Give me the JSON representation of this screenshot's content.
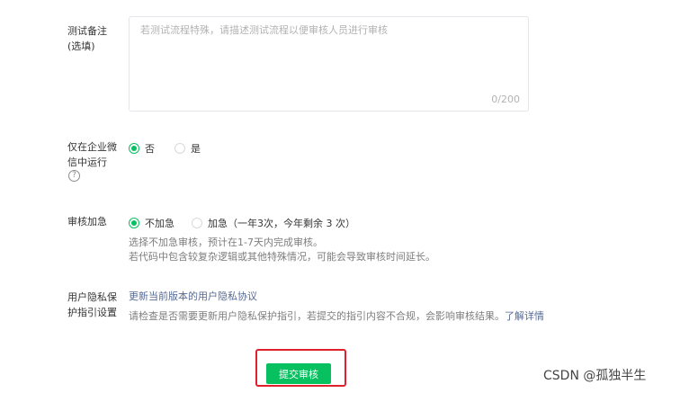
{
  "remark": {
    "label_line1": "测试备注",
    "label_line2": "(选填)",
    "placeholder": "若测试流程特殊，请描述测试流程以便审核人员进行审核",
    "counter": "0/200"
  },
  "wecom_only": {
    "label_line1": "仅在企业微",
    "label_line2": "信中运行",
    "help_icon": "?",
    "options": [
      {
        "label": "否",
        "checked": true
      },
      {
        "label": "是",
        "checked": false
      }
    ]
  },
  "urgent_review": {
    "label": "审核加急",
    "options": [
      {
        "label": "不加急",
        "checked": true
      },
      {
        "label": "加急（一年3次，今年剩余 3 次）",
        "checked": false
      }
    ],
    "desc_line1": "选择不加急审核，预计在1-7天内完成审核。",
    "desc_line2": "若代码中包含较复杂逻辑或其他特殊情况，可能会导致审核时间延长。"
  },
  "privacy": {
    "label_line1": "用户隐私保",
    "label_line2": "护指引设置",
    "update_link": "更新当前版本的用户隐私协议",
    "notice": "请检查是否需要更新用户隐私保护指引，若提交的指引内容不合规，会影响审核结果。",
    "details_link": "了解详情"
  },
  "submit_label": "提交审核",
  "watermark": "CSDN @孤独半生",
  "colors": {
    "accent": "#07c160",
    "link": "#576b95",
    "highlight": "#e0202b"
  }
}
